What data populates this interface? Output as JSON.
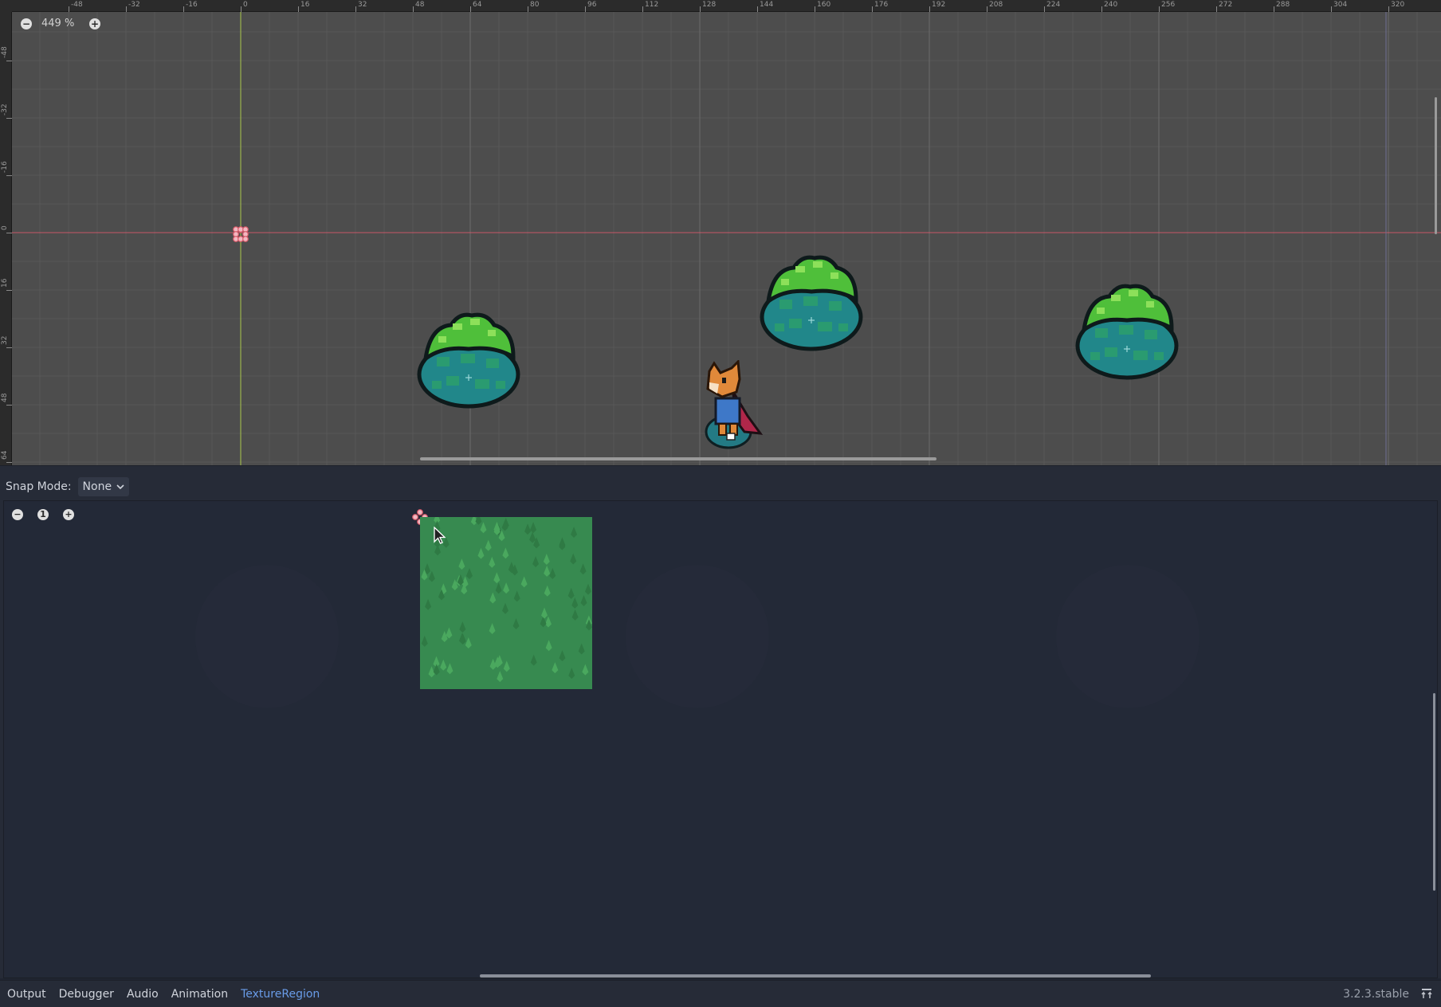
{
  "viewport": {
    "zoom_label": "449 %",
    "zoom_out_icon": "minus-circle-icon",
    "zoom_in_icon": "plus-circle-icon",
    "ruler_top_labels": [
      "-48",
      "-32",
      "-16",
      "0",
      "16",
      "32",
      "48",
      "64",
      "80",
      "96",
      "112",
      "128",
      "144",
      "160",
      "176",
      "192",
      "208",
      "224",
      "240",
      "256",
      "272",
      "288",
      "304",
      "320"
    ],
    "ruler_left_labels": [
      "-48",
      "-32",
      "-16",
      "0",
      "16",
      "32",
      "48",
      "64"
    ],
    "sprites": [
      "bush",
      "bush",
      "bush",
      "fox-player"
    ]
  },
  "texture_region": {
    "snap_label": "Snap Mode:",
    "snap_value": "None",
    "zoom_reset_label": "1"
  },
  "bottom_dock": {
    "tabs": [
      "Output",
      "Debugger",
      "Audio",
      "Animation",
      "TextureRegion"
    ],
    "active_tab": "TextureRegion",
    "version": "3.2.3.stable"
  },
  "colors": {
    "x_axis": "#c85868",
    "y_axis": "#a9c64a",
    "active_tab": "#699ce8",
    "grass": "#378a50"
  }
}
